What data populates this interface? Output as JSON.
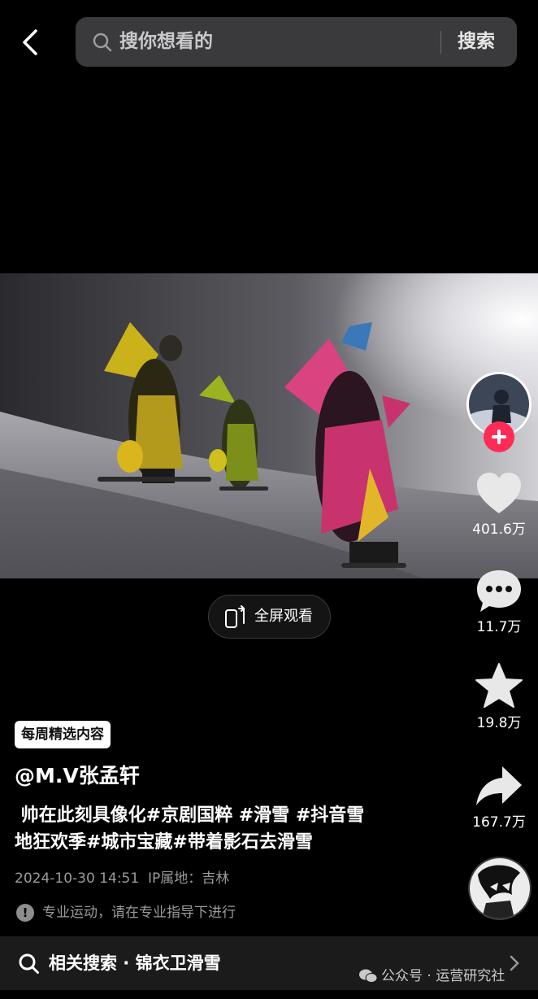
{
  "search": {
    "placeholder": "搜你想看的",
    "button_label": "搜索"
  },
  "video": {
    "fullscreen_label": "全屏观看"
  },
  "actions": {
    "likes": "401.6万",
    "comments": "11.7万",
    "favorites": "19.8万",
    "shares": "167.7万",
    "follow_color": "#fe2c55"
  },
  "post": {
    "badge": "每周精选内容",
    "author": "@M.V张孟轩",
    "description_line1": " 帅在此刻具像化#京剧国粹 #滑雪 #抖音雪",
    "description_line2": "地狂欢季#城市宝藏#带着影石去滑雪",
    "date_ip": "2024-10-30 14:51  IP属地：吉林",
    "warning": "专业运动，请在专业指导下进行"
  },
  "related": {
    "text": "相关搜索 · 锦衣卫滑雪"
  },
  "watermark": {
    "text": "公众号 · 运营研究社"
  }
}
